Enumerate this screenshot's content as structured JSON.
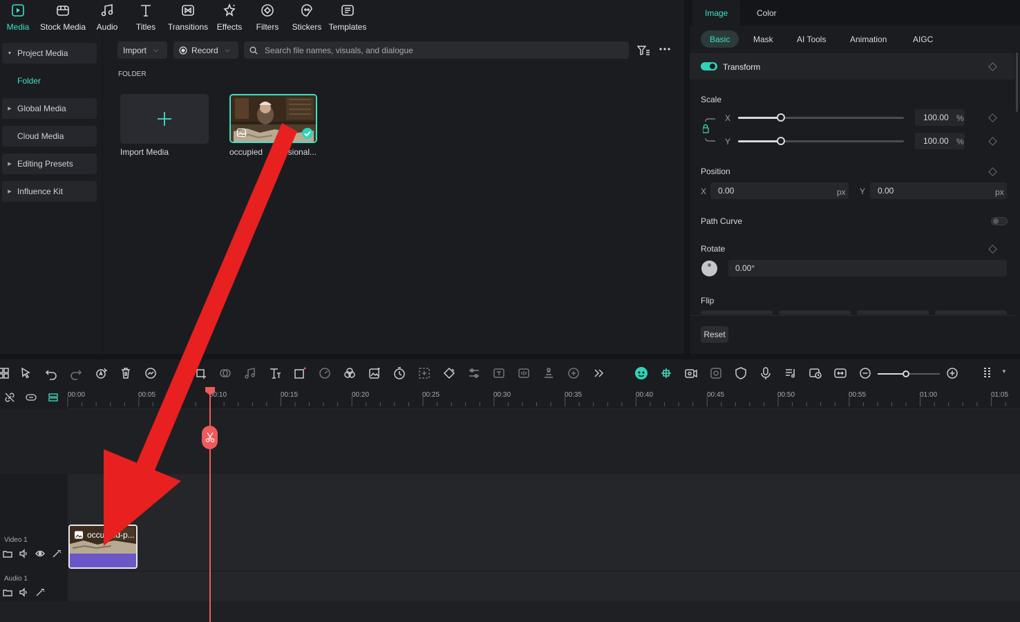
{
  "toolbar": {
    "items": [
      {
        "label": "Media",
        "icon": "media-icon",
        "active": true
      },
      {
        "label": "Stock Media",
        "icon": "stock-media-icon"
      },
      {
        "label": "Audio",
        "icon": "music-note-icon"
      },
      {
        "label": "Titles",
        "icon": "text-t-icon"
      },
      {
        "label": "Transitions",
        "icon": "transitions-icon"
      },
      {
        "label": "Effects",
        "icon": "effects-icon"
      },
      {
        "label": "Filters",
        "icon": "filters-icon"
      },
      {
        "label": "Stickers",
        "icon": "stickers-icon"
      },
      {
        "label": "Templates",
        "icon": "templates-icon"
      }
    ]
  },
  "sidebar": {
    "items": [
      {
        "label": "Project Media"
      },
      {
        "label": "Folder"
      },
      {
        "label": "Global Media"
      },
      {
        "label": "Cloud Media"
      },
      {
        "label": "Editing Presets"
      },
      {
        "label": "Influence Kit"
      }
    ]
  },
  "media": {
    "import_label": "Import",
    "record_label": "Record",
    "search_placeholder": "Search file names, visuals, and dialogue",
    "folder_heading": "FOLDER",
    "import_media_label": "Import Media",
    "clip_name": "occupied professional...",
    "clip_label_left": "occupied",
    "clip_label_right": "essional..."
  },
  "properties": {
    "tabs": [
      "Image",
      "Color"
    ],
    "subtabs": [
      "Basic",
      "Mask",
      "AI Tools",
      "Animation",
      "AIGC"
    ],
    "transform_label": "Transform",
    "scale_label": "Scale",
    "scale_x_label": "X",
    "scale_y_label": "Y",
    "scale_x_value": "100.00",
    "scale_y_value": "100.00",
    "percent_unit": "%",
    "position_label": "Position",
    "pos_x_label": "X",
    "pos_y_label": "Y",
    "pos_x_value": "0.00",
    "pos_y_value": "0.00",
    "px_unit": "px",
    "path_curve_label": "Path Curve",
    "rotate_label": "Rotate",
    "rotate_value": "0.00°",
    "flip_label": "Flip",
    "reset_label": "Reset"
  },
  "timeline": {
    "ticks": [
      "00:00",
      "00:05",
      "00:10",
      "00:15",
      "00:20",
      "00:25",
      "00:30",
      "00:35",
      "00:40",
      "00:45",
      "00:50",
      "00:55",
      "01:00",
      "01:05"
    ],
    "video_track_label": "Video 1",
    "audio_track_label": "Audio 1",
    "clip_title": "occupied-p..."
  },
  "colors": {
    "accent": "#3fe0c5",
    "playhead": "#f05a5a",
    "annotation_arrow": "#e82020",
    "clip_audio_bar": "#6b57c7"
  }
}
